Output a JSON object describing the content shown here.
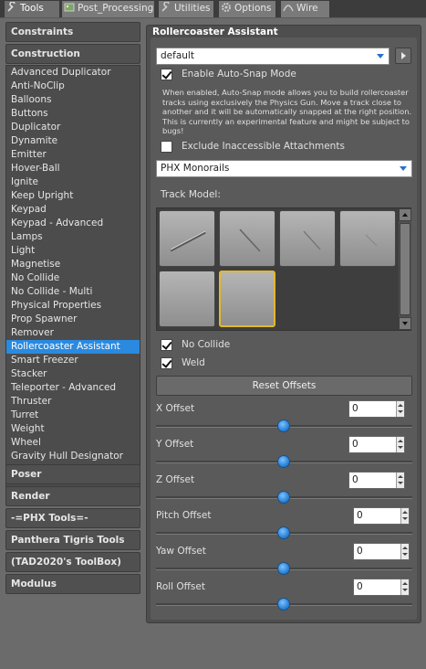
{
  "tabs": [
    {
      "label": "Tools",
      "icon": "wrench-icon",
      "active": true
    },
    {
      "label": "Post_Processing",
      "icon": "image-icon",
      "active": false
    },
    {
      "label": "Utilities",
      "icon": "wrench-icon",
      "active": false
    },
    {
      "label": "Options",
      "icon": "gear-icon",
      "active": false
    },
    {
      "label": "Wire",
      "icon": "wire-icon",
      "active": false
    }
  ],
  "categories": {
    "constraints": "Constraints",
    "construction": "Construction",
    "poser": "Poser",
    "render": "Render",
    "phx": "-=PHX Tools=-",
    "panthera": "Panthera Tigris Tools",
    "tad": "(TAD2020's ToolBox)",
    "modulus": "Modulus"
  },
  "construction_items": [
    "Advanced Duplicator",
    "Anti-NoClip",
    "Balloons",
    "Buttons",
    "Duplicator",
    "Dynamite",
    "Emitter",
    "Hover-Ball",
    "Ignite",
    "Keep Upright",
    "Keypad",
    "Keypad - Advanced",
    "Lamps",
    "Light",
    "Magnetise",
    "No Collide",
    "No Collide - Multi",
    "Physical Properties",
    "Prop Spawner",
    "Remover",
    "Rollercoaster Assistant",
    "Smart Freezer",
    "Stacker",
    "Teleporter - Advanced",
    "Thruster",
    "Turret",
    "Weight",
    "Wheel",
    "Gravity Hull Designator"
  ],
  "selected_item": "Rollercoaster Assistant",
  "panel": {
    "title": "Rollercoaster Assistant",
    "preset_value": "default",
    "autosnap_label": "Enable Auto-Snap Mode",
    "autosnap_checked": true,
    "help_lines": [
      "When enabled, Auto-Snap mode allows you to build rollercoaster",
      "tracks using exclusively the Physics Gun. Move a track close to",
      "another and it will be automatically snapped at the right position.",
      "This is currently an experimental feature and might be subject to",
      "bugs!"
    ],
    "exclude_label": "Exclude Inaccessible Attachments",
    "exclude_checked": false,
    "pack_value": "PHX Monorails",
    "track_model_label": "Track Model:",
    "nocollide_label": "No Collide",
    "nocollide_checked": true,
    "weld_label": "Weld",
    "weld_checked": true,
    "reset_label": "Reset Offsets",
    "offsets": [
      {
        "label": "X Offset",
        "value": "0"
      },
      {
        "label": "Y Offset",
        "value": "0"
      },
      {
        "label": "Z Offset",
        "value": "0"
      },
      {
        "label": "Pitch Offset",
        "value": "0"
      },
      {
        "label": "Yaw Offset",
        "value": "0"
      },
      {
        "label": "Roll Offset",
        "value": "0"
      }
    ]
  },
  "colors": {
    "selection": "#2a8ae0",
    "tile_highlight": "#e2b830",
    "slider_knob": "#2b86d8"
  }
}
